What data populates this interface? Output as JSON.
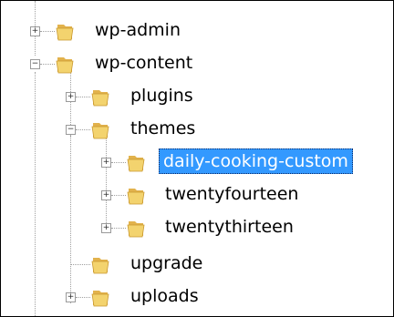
{
  "tree": [
    {
      "label": "wp-admin",
      "expander": "+",
      "level": 0
    },
    {
      "label": "wp-content",
      "expander": "−",
      "level": 0
    },
    {
      "label": "plugins",
      "expander": "+",
      "level": 1
    },
    {
      "label": "themes",
      "expander": "−",
      "level": 1
    },
    {
      "label": "daily-cooking-custom",
      "expander": "+",
      "level": 2,
      "selected": true
    },
    {
      "label": "twentyfourteen",
      "expander": "+",
      "level": 2
    },
    {
      "label": "twentythirteen",
      "expander": "+",
      "level": 2
    },
    {
      "label": "upgrade",
      "expander": "",
      "level": 1
    },
    {
      "label": "uploads",
      "expander": "+",
      "level": 1
    }
  ],
  "colors": {
    "selection": "#3399ff",
    "folder": "#f3d36e"
  }
}
